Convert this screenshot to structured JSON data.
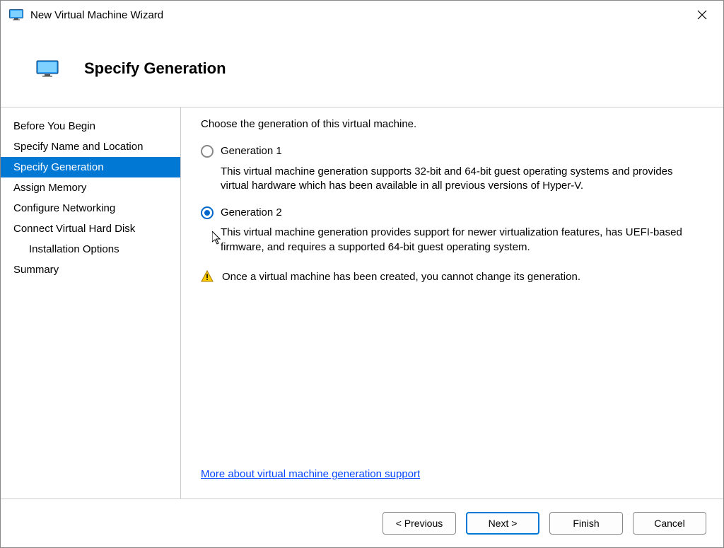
{
  "window": {
    "title": "New Virtual Machine Wizard"
  },
  "header": {
    "title": "Specify Generation"
  },
  "sidebar": {
    "items": [
      {
        "label": "Before You Begin"
      },
      {
        "label": "Specify Name and Location"
      },
      {
        "label": "Specify Generation"
      },
      {
        "label": "Assign Memory"
      },
      {
        "label": "Configure Networking"
      },
      {
        "label": "Connect Virtual Hard Disk"
      },
      {
        "label": "Installation Options"
      },
      {
        "label": "Summary"
      }
    ]
  },
  "content": {
    "intro": "Choose the generation of this virtual machine.",
    "option1": {
      "label": "Generation 1",
      "desc": "This virtual machine generation supports 32-bit and 64-bit guest operating systems and provides virtual hardware which has been available in all previous versions of Hyper-V."
    },
    "option2": {
      "label": "Generation 2",
      "desc": "This virtual machine generation provides support for newer virtualization features, has UEFI-based firmware, and requires a supported 64-bit guest operating system."
    },
    "warning": "Once a virtual machine has been created, you cannot change its generation.",
    "link": "More about virtual machine generation support"
  },
  "footer": {
    "previous": "< Previous",
    "next": "Next >",
    "finish": "Finish",
    "cancel": "Cancel"
  }
}
